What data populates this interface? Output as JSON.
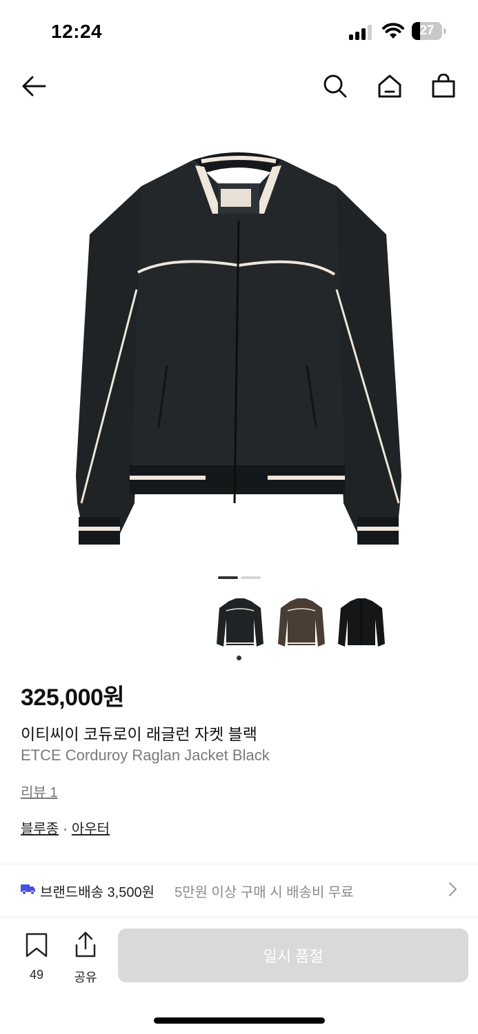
{
  "status_bar": {
    "time": "12:24",
    "battery": "27",
    "battery_level": 0.27
  },
  "nav": {
    "icons": [
      "back-arrow-icon",
      "search-icon",
      "home-icon",
      "shopping-bag-icon"
    ]
  },
  "gallery": {
    "image_count": 2,
    "current_image": 1,
    "thumbnails": [
      "black-jacket",
      "brown-jacket",
      "black-jacket-back"
    ],
    "selected_thumbnail": 1
  },
  "product": {
    "price": "325,000원",
    "name_ko": "이티씨이 코듀로이 래글런 자켓 블랙",
    "name_en": "ETCE Corduroy Raglan Jacket Black",
    "review_label": "리뷰 1",
    "category_1": "블루종",
    "category_sep": "·",
    "category_2": "아우터"
  },
  "shipping": {
    "main": "브랜드배송 3,500원",
    "sub": "5만원 이상 구매 시 배송비 무료"
  },
  "bottom_bar": {
    "bookmark_count": "49",
    "share_label": "공유",
    "buy_button": "일시 품절"
  },
  "colors": {
    "accent_blue": "#4a4fe0",
    "sold_out_bg": "#d9d9d9",
    "jacket_black": "#1f2326",
    "jacket_brown": "#4a3d33",
    "trim": "#efe6dc"
  }
}
